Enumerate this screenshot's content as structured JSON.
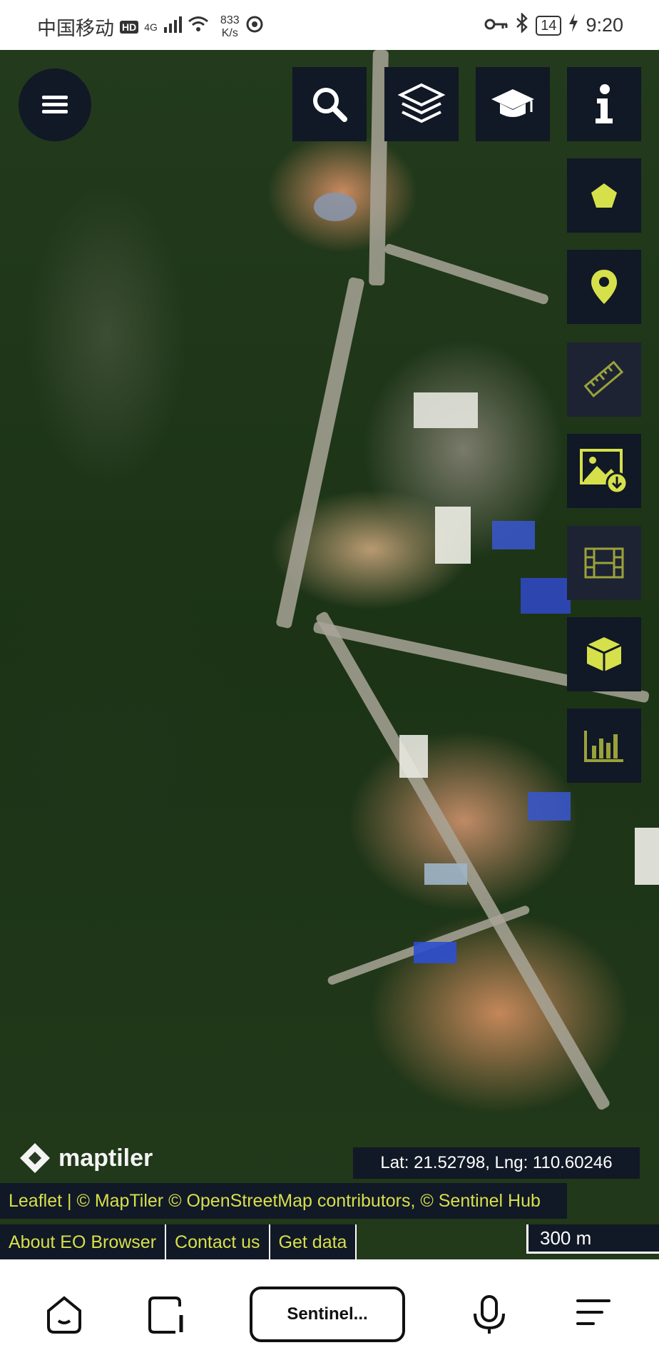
{
  "status_bar": {
    "carrier": "中国移动",
    "hd": "HD",
    "network": "4G",
    "speed_value": "833",
    "speed_unit": "K/s",
    "battery": "14",
    "time": "9:20"
  },
  "map": {
    "coordinates": "Lat: 21.52798, Lng: 110.60246",
    "attribution": "Leaflet | © MapTiler © OpenStreetMap contributors, © Sentinel Hub",
    "logo_text": "maptiler",
    "scale": "300 m"
  },
  "toolbar": {
    "menu_icon": "menu-icon",
    "buttons": [
      "search-icon",
      "layers-icon",
      "education-icon",
      "info-icon"
    ]
  },
  "side_tools": [
    "pentagon-icon",
    "pin-icon",
    "ruler-icon",
    "image-download-icon",
    "film-icon",
    "cube-icon",
    "chart-icon"
  ],
  "footer_links": [
    "About EO Browser",
    "Contact us",
    "Get data"
  ],
  "bottom_nav": {
    "pill_label": "Sentinel..."
  },
  "colors": {
    "accent": "#d6e04a",
    "panel": "#111826"
  }
}
